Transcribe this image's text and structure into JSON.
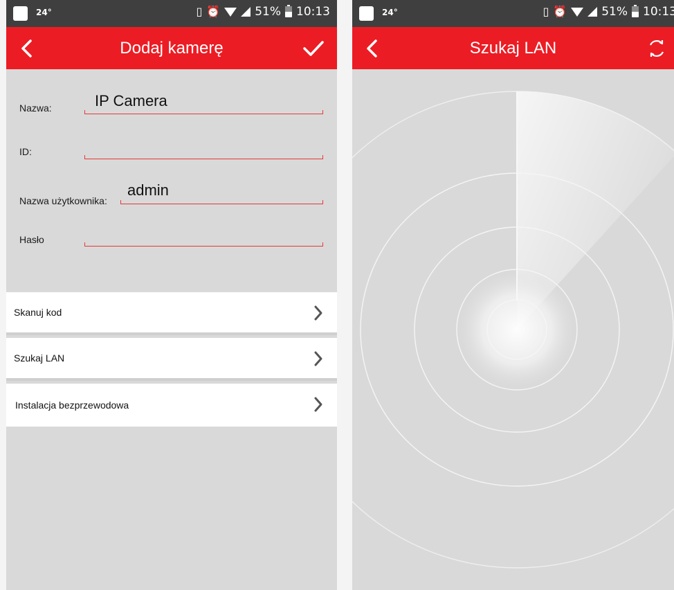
{
  "status_bar": {
    "temperature": "24°",
    "battery": "51%",
    "time": "10:13"
  },
  "add_camera": {
    "title": "Dodaj kamerę",
    "back_icon": "chevron-left-icon",
    "confirm_icon": "checkmark-icon",
    "fields": [
      {
        "label": "Nazwa:",
        "value": "IP Camera"
      },
      {
        "label": "ID:",
        "value": ""
      },
      {
        "label": "Nazwa użytkownika:",
        "value": "admin"
      },
      {
        "label": "Hasło",
        "value": ""
      }
    ],
    "menu": [
      {
        "label": "Skanuj kod"
      },
      {
        "label": "Szukaj LAN"
      },
      {
        "label": "Instalacja bezprzewodowa"
      }
    ]
  },
  "lan_search": {
    "title": "Szukaj LAN",
    "back_icon": "chevron-left-icon",
    "refresh_icon": "refresh-icon"
  },
  "colors": {
    "accent": "#ec1c24",
    "status_bar": "#3f3f3f",
    "background": "#d9d9d9",
    "field_underline": "#e53935"
  }
}
